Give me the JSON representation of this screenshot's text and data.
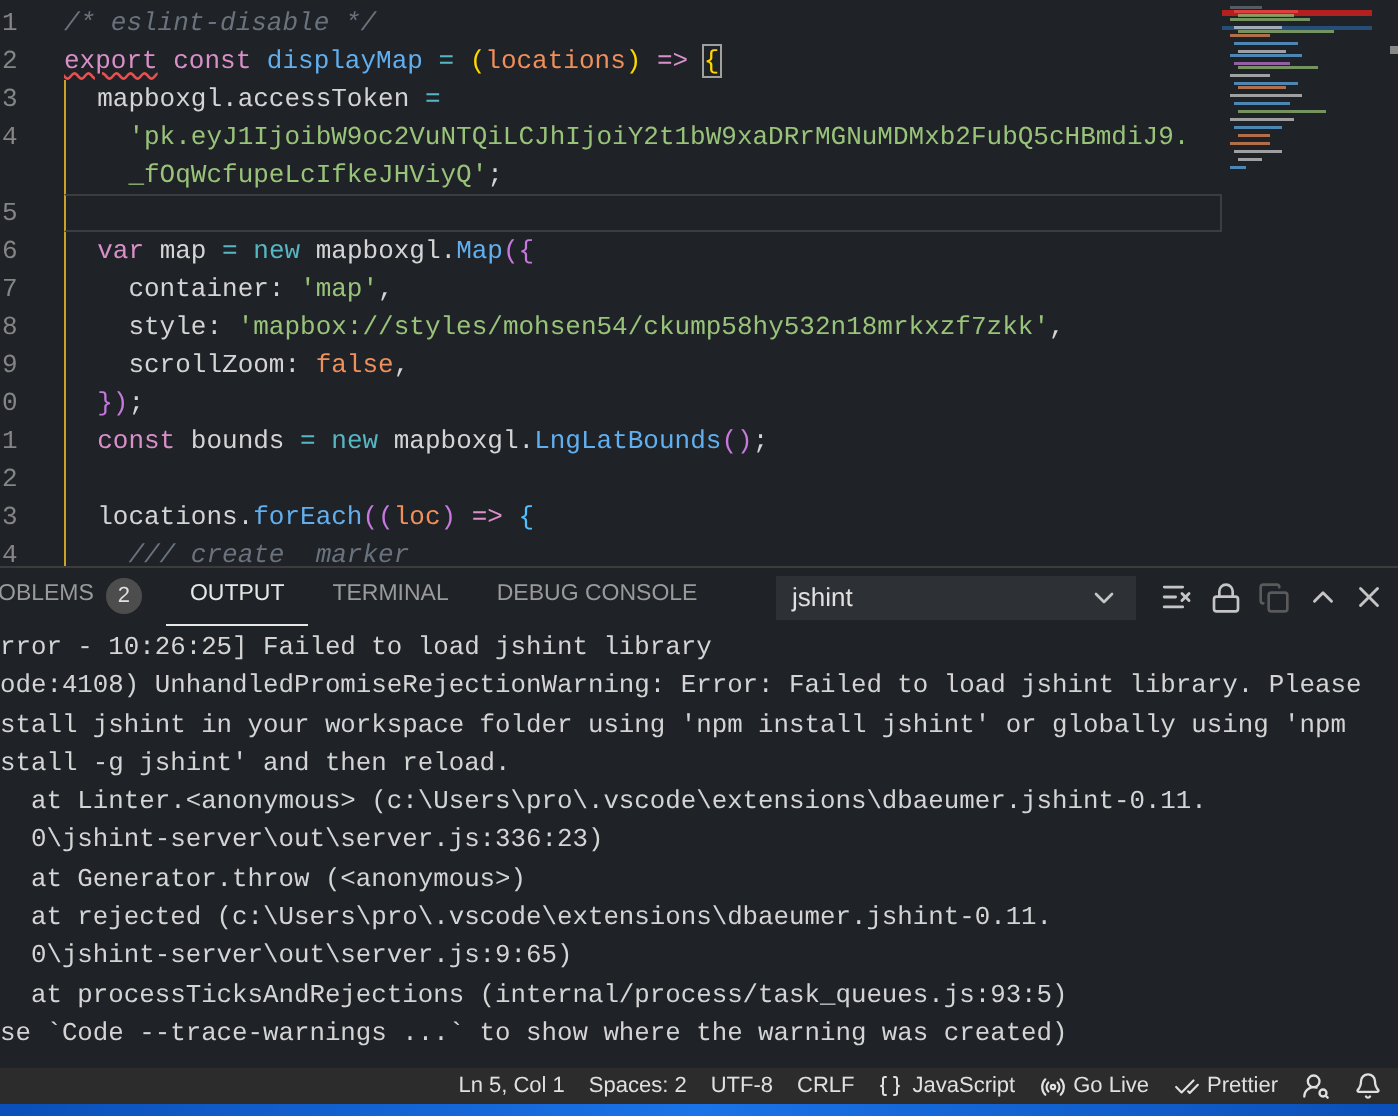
{
  "editor": {
    "lines": [
      {
        "number": "1",
        "current": false,
        "tokens": [
          {
            "text": "/* eslint-disable */",
            "kind": "comment"
          }
        ]
      },
      {
        "number": "2",
        "current": false,
        "tokens": [
          {
            "text": "export",
            "kind": "keyword_error"
          },
          {
            "text": " const ",
            "kind": "keyword"
          },
          {
            "text": "displayMap",
            "kind": "fn"
          },
          {
            "text": " = ",
            "kind": "op"
          },
          {
            "text": "(",
            "kind": "bracket1"
          },
          {
            "text": "locations",
            "kind": "param"
          },
          {
            "text": ")",
            "kind": "bracket1"
          },
          {
            "text": " => ",
            "kind": "keyword"
          },
          {
            "text": "{",
            "kind": "bracket_match"
          }
        ]
      },
      {
        "number": "3",
        "current": false,
        "tokens": [
          {
            "text": "  mapboxgl.accessToken",
            "kind": "plain"
          },
          {
            "text": " =",
            "kind": "op"
          }
        ]
      },
      {
        "number": "4",
        "current": false,
        "tokens": [
          {
            "text": "    'pk.eyJ1IjoibW9oc2VuNTQiLCJhIjoiY2t1bW9xaDRrMGNuMDMxb2FubQ5cHBmdiJ9.",
            "kind": "string"
          }
        ]
      },
      {
        "current": false,
        "tokens": [
          {
            "text": "    _fOqWcfupeLcIfkeJHViyQ'",
            "kind": "string"
          },
          {
            "text": ";",
            "kind": "plain"
          }
        ]
      },
      {
        "number": "5",
        "current": true
      },
      {
        "number": "6",
        "current": false,
        "tokens": [
          {
            "text": "  var",
            "kind": "keyword"
          },
          {
            "text": " map ",
            "kind": "plain"
          },
          {
            "text": "=",
            "kind": "op"
          },
          {
            "text": " new ",
            "kind": "new"
          },
          {
            "text": "mapboxgl.",
            "kind": "plain"
          },
          {
            "text": "Map",
            "kind": "fn"
          },
          {
            "text": "({",
            "kind": "bracket2"
          }
        ]
      },
      {
        "number": "7",
        "current": false,
        "tokens": [
          {
            "text": "    container: ",
            "kind": "plain"
          },
          {
            "text": "'map'",
            "kind": "string"
          },
          {
            "text": ",",
            "kind": "plain"
          }
        ]
      },
      {
        "number": "8",
        "current": false,
        "tokens": [
          {
            "text": "    style: ",
            "kind": "plain"
          },
          {
            "text": "'mapbox://styles/mohsen54/ckump58hy532n18mrkxzf7zkk'",
            "kind": "string"
          },
          {
            "text": ",",
            "kind": "plain"
          }
        ]
      },
      {
        "number": "9",
        "current": false,
        "tokens": [
          {
            "text": "    scrollZoom: ",
            "kind": "plain"
          },
          {
            "text": "false",
            "kind": "bool"
          },
          {
            "text": ",",
            "kind": "plain"
          }
        ]
      },
      {
        "number": "0",
        "current": false,
        "tokens": [
          {
            "text": "  })",
            "kind": "bracket2"
          },
          {
            "text": ";",
            "kind": "plain"
          }
        ]
      },
      {
        "number": "1",
        "current": false,
        "tokens": [
          {
            "text": "  const",
            "kind": "keyword"
          },
          {
            "text": " bounds ",
            "kind": "plain"
          },
          {
            "text": "=",
            "kind": "op"
          },
          {
            "text": " new ",
            "kind": "new"
          },
          {
            "text": "mapboxgl.",
            "kind": "plain"
          },
          {
            "text": "LngLatBounds",
            "kind": "fn"
          },
          {
            "text": "()",
            "kind": "bracket2"
          },
          {
            "text": ";",
            "kind": "plain"
          }
        ]
      },
      {
        "number": "2",
        "current": false
      },
      {
        "number": "3",
        "current": false,
        "tokens": [
          {
            "text": "  locations.",
            "kind": "plain"
          },
          {
            "text": "forEach",
            "kind": "fn"
          },
          {
            "text": "((",
            "kind": "bracket2"
          },
          {
            "text": "loc",
            "kind": "param"
          },
          {
            "text": ")",
            "kind": "bracket2"
          },
          {
            "text": " => ",
            "kind": "keyword"
          },
          {
            "text": "{",
            "kind": "bracket3"
          }
        ]
      },
      {
        "number": "4",
        "current": false,
        "tokens": [
          {
            "text": "    /// create  marker",
            "kind": "comment"
          }
        ]
      }
    ]
  },
  "panel": {
    "tabs": [
      {
        "label": "OBLEMS",
        "badge": "2",
        "selected": false
      },
      {
        "label": "OUTPUT",
        "selected": true
      },
      {
        "label": "TERMINAL",
        "selected": false
      },
      {
        "label": "DEBUG CONSOLE",
        "selected": false
      }
    ],
    "channel": "jshint",
    "output": [
      "rror - 10:26:25] Failed to load jshint library",
      "ode:4108) UnhandledPromiseRejectionWarning: Error: Failed to load jshint library. Please",
      "stall jshint in your workspace folder using 'npm install jshint' or globally using 'npm",
      "stall -g jshint' and then reload.",
      "  at Linter.<anonymous> (c:\\Users\\pro\\.vscode\\extensions\\dbaeumer.jshint-0.11.",
      "  0\\jshint-server\\out\\server.js:336:23)",
      "  at Generator.throw (<anonymous>)",
      "  at rejected (c:\\Users\\pro\\.vscode\\extensions\\dbaeumer.jshint-0.11.",
      "  0\\jshint-server\\out\\server.js:9:65)",
      "  at processTicksAndRejections (internal/process/task_queues.js:93:5)",
      "se `Code --trace-warnings ...` to show where the warning was created)"
    ]
  },
  "status_bar": {
    "position": "Ln 5, Col 1",
    "indent": "Spaces: 2",
    "encoding": "UTF-8",
    "eol": "CRLF",
    "language": "JavaScript",
    "live": "Go Live",
    "formatter": "Prettier"
  }
}
